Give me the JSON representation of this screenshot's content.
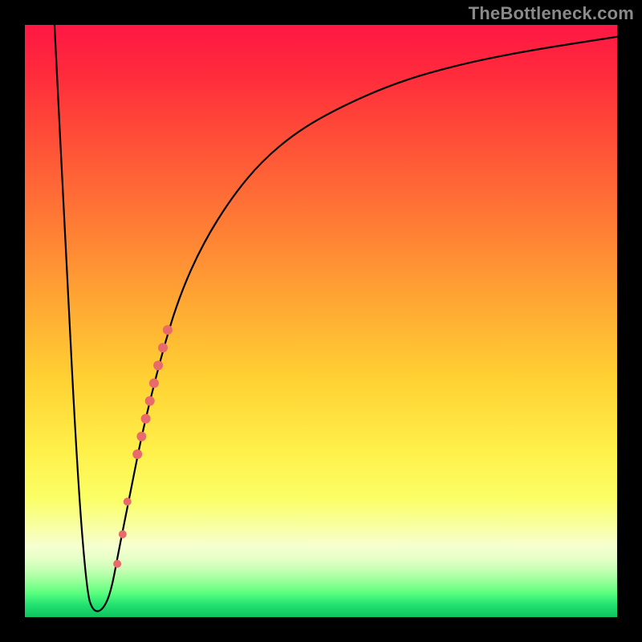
{
  "watermark": {
    "text": "TheBottleneck.com"
  },
  "colors": {
    "curve_stroke": "#000000",
    "marker_fill": "#e86a6a",
    "marker_stroke": "#e86a6a"
  },
  "chart_data": {
    "type": "line",
    "title": "",
    "xlabel": "",
    "ylabel": "",
    "xlim": [
      0,
      100
    ],
    "ylim": [
      0,
      100
    ],
    "grid": false,
    "legend": false,
    "series": [
      {
        "name": "bottleneck-curve",
        "x": [
          5,
          7,
          9,
          10.5,
          11.5,
          13,
          14.5,
          16,
          18,
          20,
          23,
          26,
          30,
          35,
          40,
          46,
          53,
          62,
          72,
          84,
          100
        ],
        "y": [
          100,
          60,
          22,
          4,
          1,
          1,
          4,
          12,
          22,
          32,
          44,
          54,
          63,
          71,
          77,
          82,
          86,
          90,
          93,
          95.5,
          98
        ]
      }
    ],
    "markers": [
      {
        "x": 19.0,
        "y": 27.5,
        "r": 5.5
      },
      {
        "x": 19.7,
        "y": 30.5,
        "r": 5.5
      },
      {
        "x": 20.4,
        "y": 33.5,
        "r": 5.5
      },
      {
        "x": 21.1,
        "y": 36.5,
        "r": 5.5
      },
      {
        "x": 21.8,
        "y": 39.5,
        "r": 5.5
      },
      {
        "x": 22.5,
        "y": 42.5,
        "r": 5.5
      },
      {
        "x": 23.3,
        "y": 45.5,
        "r": 5.5
      },
      {
        "x": 24.1,
        "y": 48.5,
        "r": 5.5
      },
      {
        "x": 17.3,
        "y": 19.5,
        "r": 4.5
      },
      {
        "x": 16.5,
        "y": 14.0,
        "r": 4.5
      },
      {
        "x": 15.6,
        "y": 9.0,
        "r": 4.5
      }
    ]
  }
}
